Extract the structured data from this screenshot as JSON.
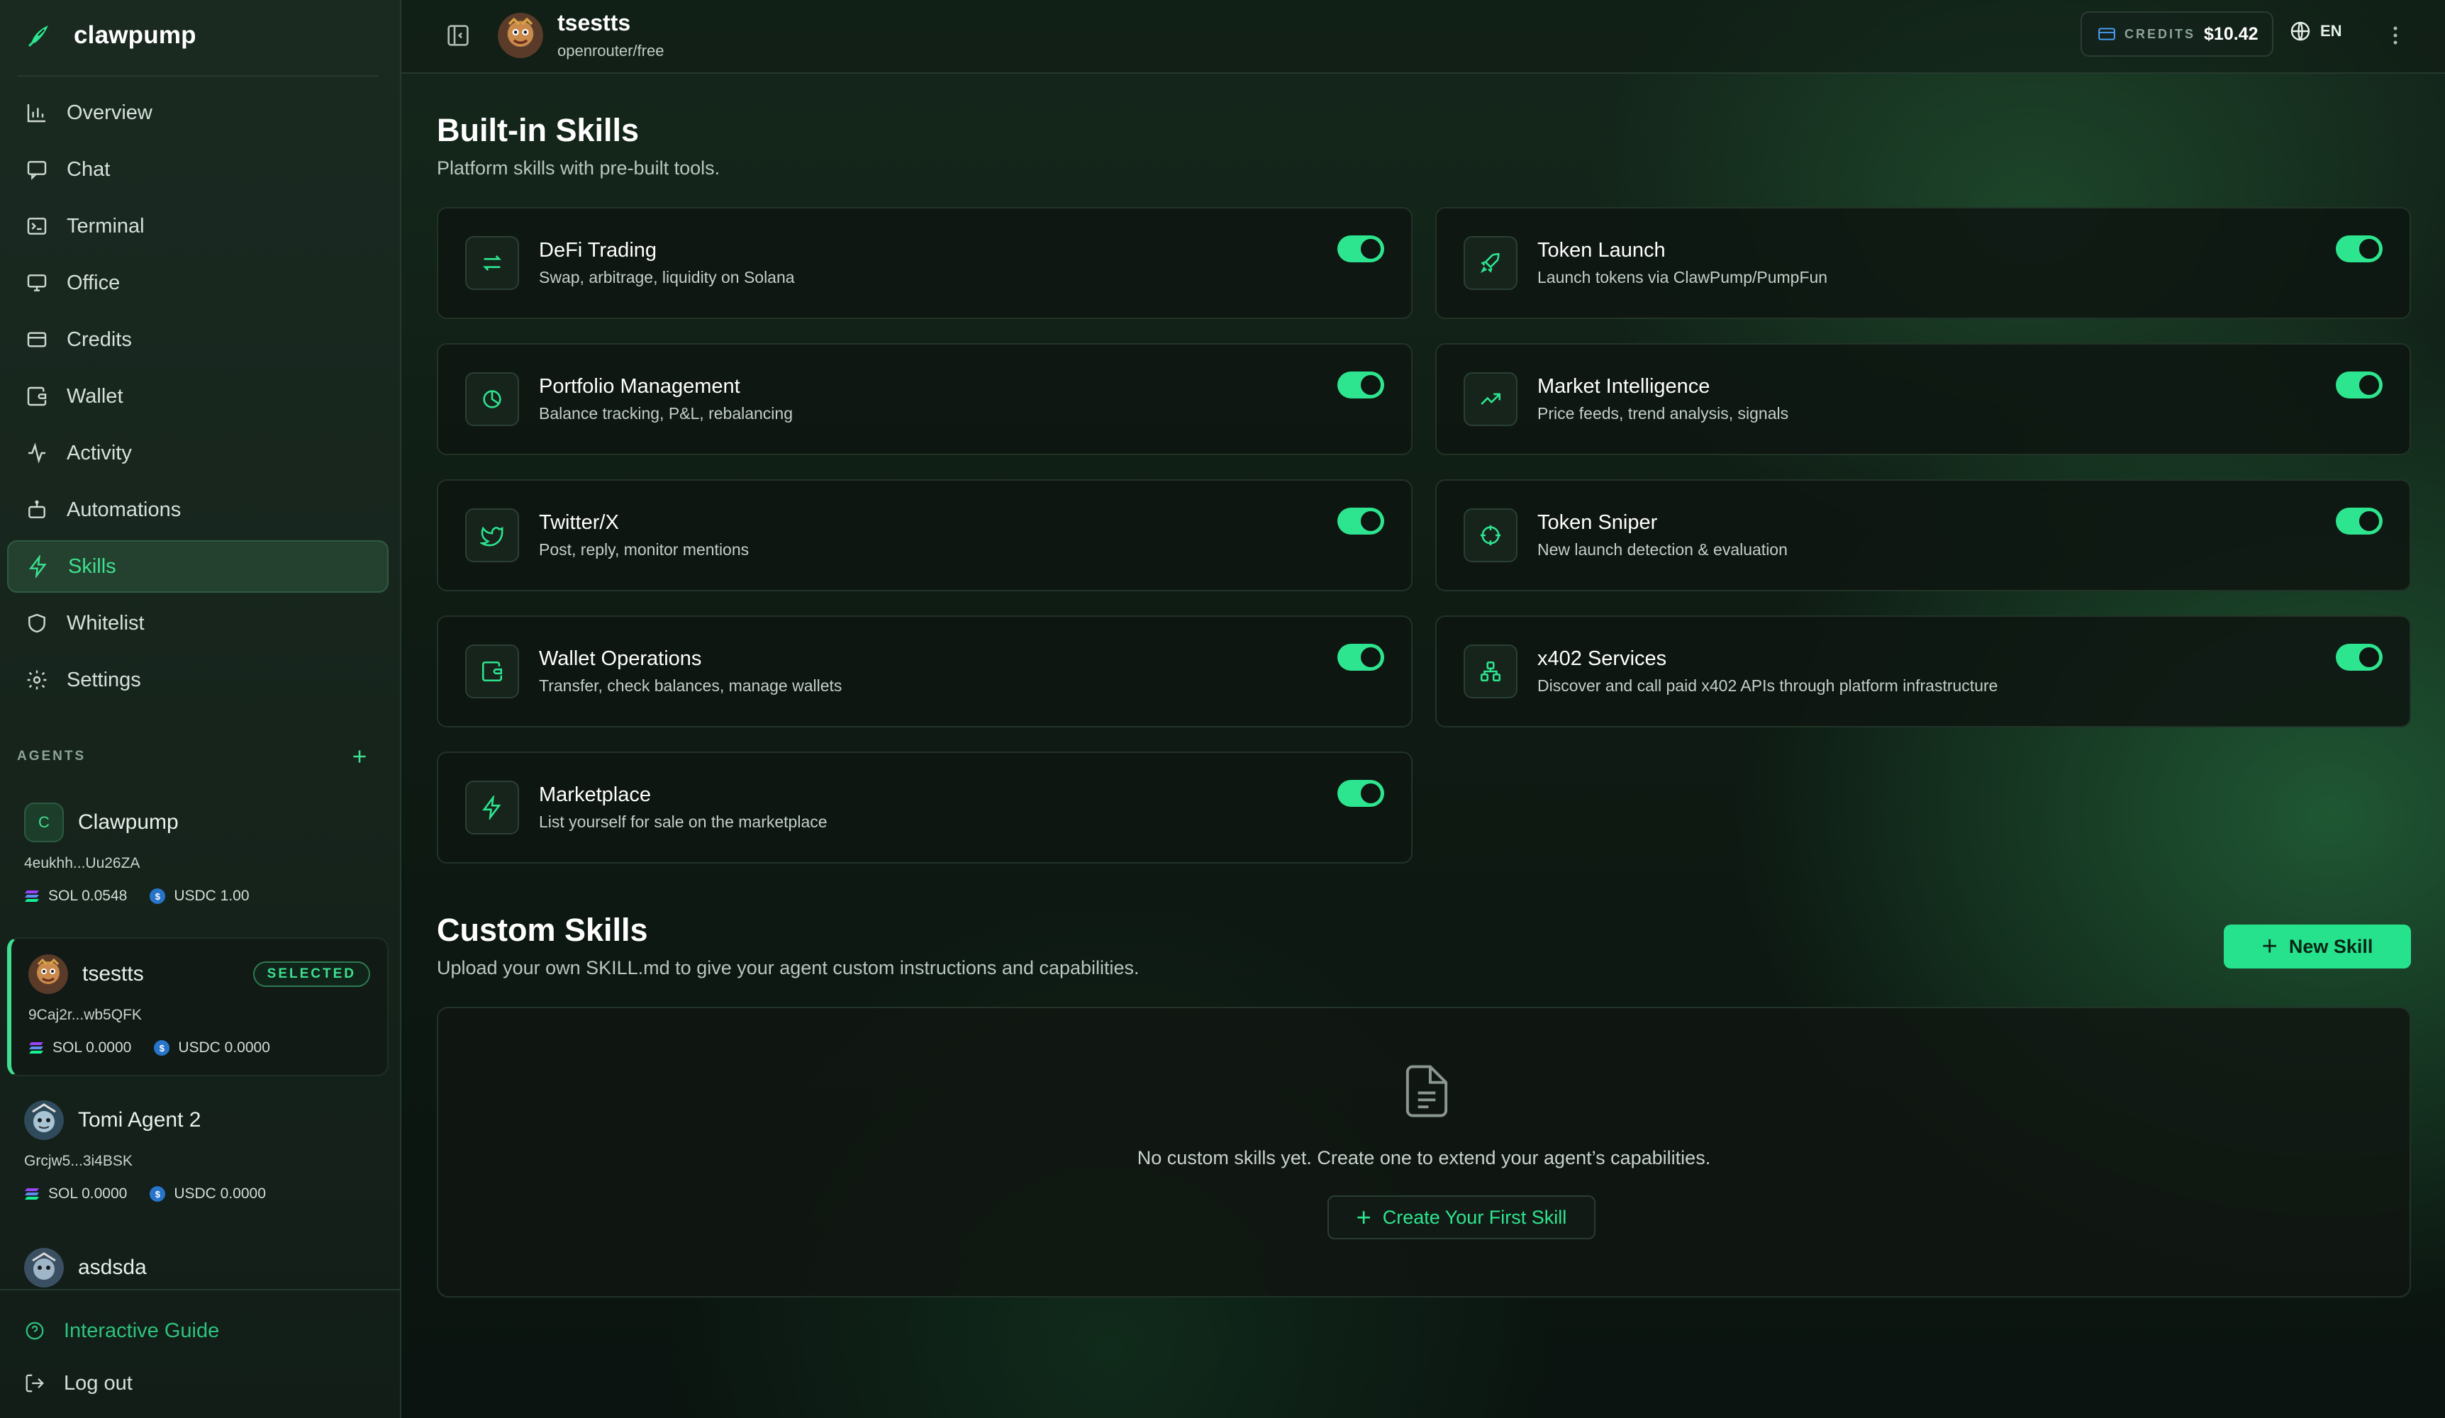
{
  "app": {
    "name": "clawpump"
  },
  "sidebar": {
    "nav": [
      {
        "label": "Overview",
        "icon": "bar-chart-icon"
      },
      {
        "label": "Chat",
        "icon": "chat-icon"
      },
      {
        "label": "Terminal",
        "icon": "terminal-icon"
      },
      {
        "label": "Office",
        "icon": "monitor-icon"
      },
      {
        "label": "Credits",
        "icon": "credit-card-icon"
      },
      {
        "label": "Wallet",
        "icon": "wallet-icon"
      },
      {
        "label": "Activity",
        "icon": "activity-icon"
      },
      {
        "label": "Automations",
        "icon": "robot-icon"
      },
      {
        "label": "Skills",
        "icon": "lightning-icon",
        "active": true
      },
      {
        "label": "Whitelist",
        "icon": "shield-icon"
      },
      {
        "label": "Settings",
        "icon": "gear-icon"
      }
    ],
    "agents_title": "AGENTS",
    "agents": [
      {
        "name": "Clawpump",
        "avatar_letter": "C",
        "address": "4eukhh...Uu26ZA",
        "sol": "SOL 0.0548",
        "usdc": "USDC 1.00"
      },
      {
        "name": "tsestts",
        "badge": "SELECTED",
        "address": "9Caj2r...wb5QFK",
        "sol": "SOL 0.0000",
        "usdc": "USDC 0.0000"
      },
      {
        "name": "Tomi Agent 2",
        "address": "Grcjw5...3i4BSK",
        "sol": "SOL 0.0000",
        "usdc": "USDC 0.0000"
      },
      {
        "name": "asdsda"
      }
    ],
    "footer": {
      "guide": "Interactive Guide",
      "logout": "Log out"
    }
  },
  "header": {
    "agent_name": "tsestts",
    "model": "openrouter/free",
    "credits_label": "CREDITS",
    "credits_value": "$10.42",
    "language": "EN"
  },
  "builtin": {
    "title": "Built-in Skills",
    "subtitle": "Platform skills with pre-built tools.",
    "skills": [
      {
        "name": "DeFi Trading",
        "desc": "Swap, arbitrage, liquidity on Solana",
        "icon": "swap-arrows-icon",
        "enabled": true
      },
      {
        "name": "Token Launch",
        "desc": "Launch tokens via ClawPump/PumpFun",
        "icon": "rocket-icon",
        "enabled": true
      },
      {
        "name": "Portfolio Management",
        "desc": "Balance tracking, P&L, rebalancing",
        "icon": "pie-chart-icon",
        "enabled": true
      },
      {
        "name": "Market Intelligence",
        "desc": "Price feeds, trend analysis, signals",
        "icon": "trending-up-icon",
        "enabled": true
      },
      {
        "name": "Twitter/X",
        "desc": "Post, reply, monitor mentions",
        "icon": "twitter-bird-icon",
        "enabled": true
      },
      {
        "name": "Token Sniper",
        "desc": "New launch detection & evaluation",
        "icon": "crosshair-icon",
        "enabled": true
      },
      {
        "name": "Wallet Operations",
        "desc": "Transfer, check balances, manage wallets",
        "icon": "wallet-icon",
        "enabled": true
      },
      {
        "name": "x402 Services",
        "desc": "Discover and call paid x402 APIs through platform infrastructure",
        "icon": "network-icon",
        "enabled": true
      },
      {
        "name": "Marketplace",
        "desc": "List yourself for sale on the marketplace",
        "icon": "lightning-icon",
        "enabled": true
      }
    ]
  },
  "custom": {
    "title": "Custom Skills",
    "subtitle": "Upload your own SKILL.md to give your agent custom instructions and capabilities.",
    "new_button": "New Skill",
    "empty_text": "No custom skills yet. Create one to extend your agent’s capabilities.",
    "create_button": "Create Your First Skill"
  },
  "colors": {
    "accent": "#2ee58f",
    "background": "#0c1410",
    "sidebar": "#16241c"
  }
}
